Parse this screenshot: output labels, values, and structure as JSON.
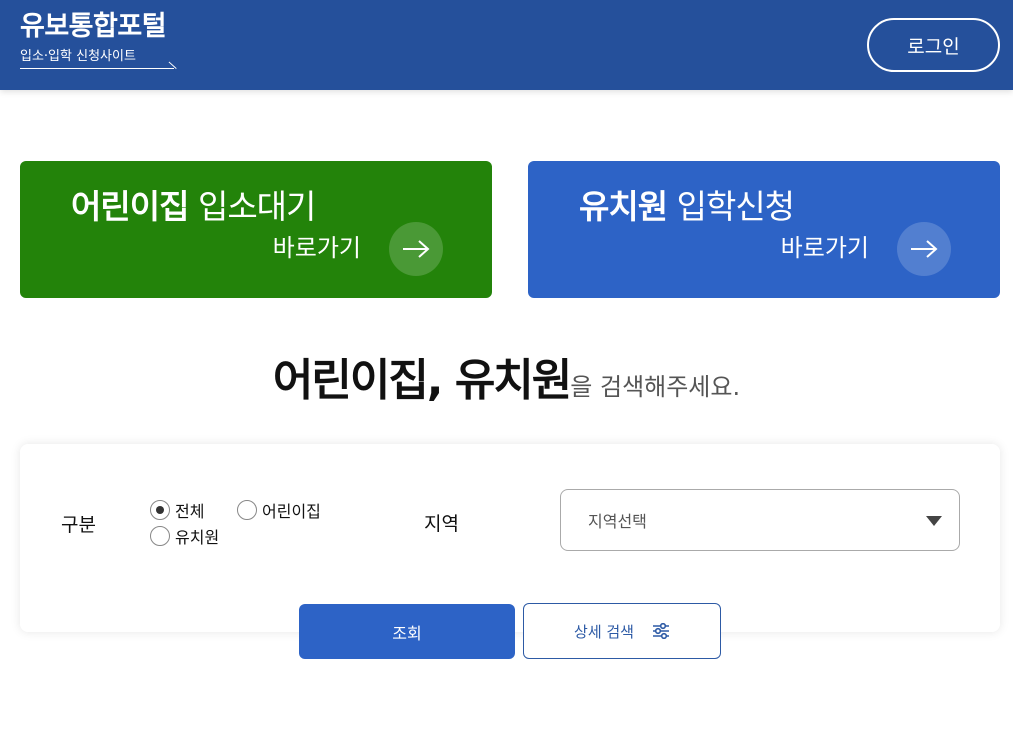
{
  "header": {
    "title": "유보통합포털",
    "subtitle": "입소·입학 신청사이트",
    "login_label": "로그인",
    "background": "#25509b"
  },
  "cards": [
    {
      "title_strong": "어린이집",
      "title_light": "입소대기",
      "go_label": "바로가기",
      "color": "#23830a",
      "icon": "arrow-right-icon"
    },
    {
      "title_strong": "유치원",
      "title_light": "입학신청",
      "go_label": "바로가기",
      "color": "#2d63c6",
      "icon": "arrow-right-icon"
    }
  ],
  "headline": {
    "strong": "어린이집, 유치원",
    "light": "을 검색해주세요."
  },
  "search": {
    "category_label": "구분",
    "options": [
      {
        "label": "전체",
        "selected": true
      },
      {
        "label": "어린이집",
        "selected": false
      },
      {
        "label": "유치원",
        "selected": false
      }
    ],
    "region_label": "지역",
    "region_select_value": "지역선택",
    "search_button": "조회",
    "detail_button": "상세 검색",
    "detail_icon": "filter-sliders-icon"
  }
}
